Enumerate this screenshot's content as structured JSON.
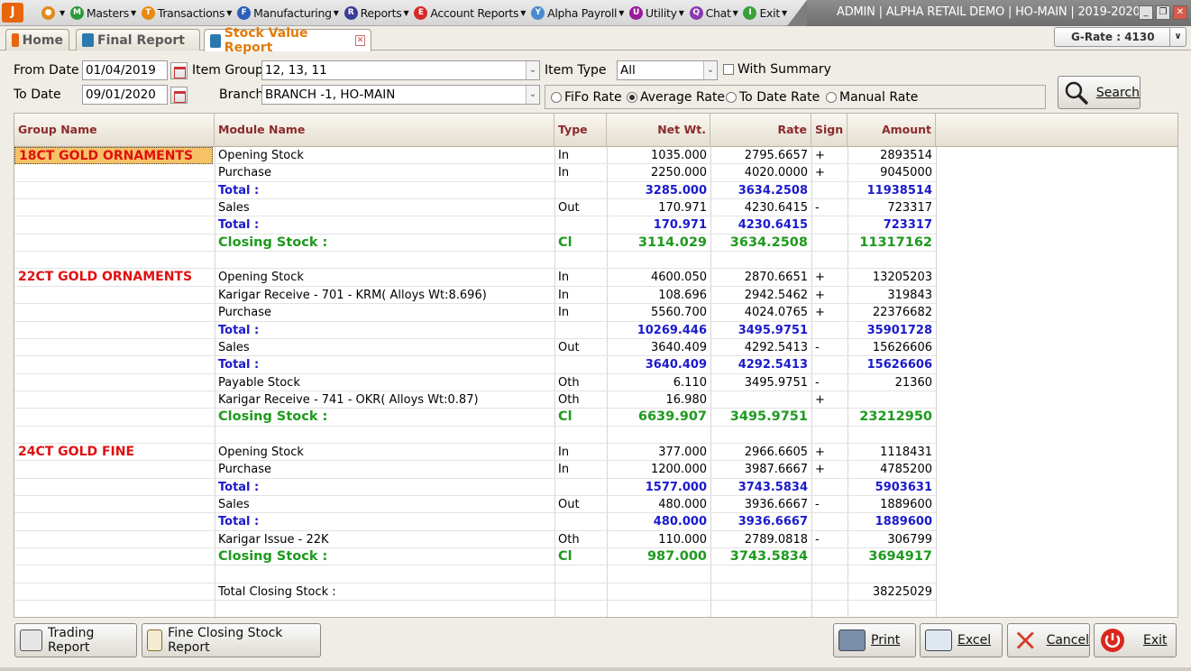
{
  "app": {
    "window_title": "ADMIN | ALPHA RETAIL DEMO | HO-MAIN | 2019-2020",
    "logo_letter": "J"
  },
  "menu": [
    {
      "label": "Masters",
      "icon": "M",
      "color": "#2a9a3a"
    },
    {
      "label": "Transactions",
      "icon": "T",
      "color": "#e88a12"
    },
    {
      "label": "Manufacturing",
      "icon": "F",
      "color": "#2b5fb8"
    },
    {
      "label": "Reports",
      "icon": "R",
      "color": "#3a3a9a"
    },
    {
      "label": "Account Reports",
      "icon": "E",
      "color": "#d62a2a"
    },
    {
      "label": "Alpha Payroll",
      "icon": "Y",
      "color": "#4a8ad0"
    },
    {
      "label": "Utility",
      "icon": "U",
      "color": "#9a1a9a"
    },
    {
      "label": "Chat",
      "icon": "Q",
      "color": "#8a3ab0"
    },
    {
      "label": "Exit",
      "icon": "I",
      "color": "#3aa03a"
    }
  ],
  "tabs": {
    "home": "Home",
    "final_report": "Final Report",
    "stock_value_report": "Stock Value Report"
  },
  "grate": "G-Rate : 4130",
  "filters": {
    "from_date_label": "From Date",
    "from_date": "01/04/2019",
    "to_date_label": "To Date",
    "to_date": "09/01/2020",
    "item_group_label": "Item Group",
    "item_group": "12, 13, 11",
    "branch_label": "Branch",
    "branch": "BRANCH -1, HO-MAIN",
    "item_type_label": "Item Type",
    "item_type": "All",
    "with_summary_label": "With Summary",
    "rates": {
      "fifo": "FiFo Rate",
      "average": "Average Rate",
      "to_date": "To Date Rate",
      "manual": "Manual Rate"
    },
    "selected_rate": "average",
    "search_label": "Search"
  },
  "grid": {
    "columns": {
      "group": "Group Name",
      "module": "Module Name",
      "type": "Type",
      "net_wt": "Net Wt.",
      "rate": "Rate",
      "sign": "Sign",
      "amount": "Amount"
    },
    "rows": [
      {
        "kind": "data",
        "group": "18CT GOLD ORNAMENTS",
        "group_selected": true,
        "module": "Opening Stock",
        "type": "In",
        "net_wt": "1035.000",
        "rate": "2795.6657",
        "sign": "+",
        "amount": "2893514"
      },
      {
        "kind": "data",
        "group": "",
        "module": "Purchase",
        "type": "In",
        "net_wt": "2250.000",
        "rate": "4020.0000",
        "sign": "+",
        "amount": "9045000"
      },
      {
        "kind": "total",
        "group": "",
        "module": "Total :",
        "type": "",
        "net_wt": "3285.000",
        "rate": "3634.2508",
        "sign": "",
        "amount": "11938514"
      },
      {
        "kind": "data",
        "group": "",
        "module": "Sales",
        "type": "Out",
        "net_wt": "170.971",
        "rate": "4230.6415",
        "sign": "-",
        "amount": "723317"
      },
      {
        "kind": "total",
        "group": "",
        "module": "Total :",
        "type": "",
        "net_wt": "170.971",
        "rate": "4230.6415",
        "sign": "",
        "amount": "723317"
      },
      {
        "kind": "closing",
        "group": "",
        "module": "Closing Stock :",
        "type": "Cl",
        "net_wt": "3114.029",
        "rate": "3634.2508",
        "sign": "",
        "amount": "11317162"
      },
      {
        "kind": "blank",
        "group": "",
        "module": "",
        "type": "",
        "net_wt": "",
        "rate": "",
        "sign": "",
        "amount": ""
      },
      {
        "kind": "data",
        "group": "22CT GOLD ORNAMENTS",
        "module": "Opening Stock",
        "type": "In",
        "net_wt": "4600.050",
        "rate": "2870.6651",
        "sign": "+",
        "amount": "13205203"
      },
      {
        "kind": "data",
        "group": "",
        "module": "Karigar Receive - 701 - KRM( Alloys Wt:8.696)",
        "type": "In",
        "net_wt": "108.696",
        "rate": "2942.5462",
        "sign": "+",
        "amount": "319843"
      },
      {
        "kind": "data",
        "group": "",
        "module": "Purchase",
        "type": "In",
        "net_wt": "5560.700",
        "rate": "4024.0765",
        "sign": "+",
        "amount": "22376682"
      },
      {
        "kind": "total",
        "group": "",
        "module": "Total :",
        "type": "",
        "net_wt": "10269.446",
        "rate": "3495.9751",
        "sign": "",
        "amount": "35901728"
      },
      {
        "kind": "data",
        "group": "",
        "module": "Sales",
        "type": "Out",
        "net_wt": "3640.409",
        "rate": "4292.5413",
        "sign": "-",
        "amount": "15626606"
      },
      {
        "kind": "total",
        "group": "",
        "module": "Total :",
        "type": "",
        "net_wt": "3640.409",
        "rate": "4292.5413",
        "sign": "",
        "amount": "15626606"
      },
      {
        "kind": "data",
        "group": "",
        "module": "Payable Stock",
        "type": "Oth",
        "net_wt": "6.110",
        "rate": "3495.9751",
        "sign": "-",
        "amount": "21360"
      },
      {
        "kind": "data",
        "group": "",
        "module": "Karigar Receive - 741 - OKR( Alloys Wt:0.87)",
        "type": "Oth",
        "net_wt": "16.980",
        "rate": "",
        "sign": "+",
        "amount": ""
      },
      {
        "kind": "closing",
        "group": "",
        "module": "Closing Stock :",
        "type": "Cl",
        "net_wt": "6639.907",
        "rate": "3495.9751",
        "sign": "",
        "amount": "23212950"
      },
      {
        "kind": "blank",
        "group": "",
        "module": "",
        "type": "",
        "net_wt": "",
        "rate": "",
        "sign": "",
        "amount": ""
      },
      {
        "kind": "data",
        "group": "24CT GOLD FINE",
        "module": "Opening Stock",
        "type": "In",
        "net_wt": "377.000",
        "rate": "2966.6605",
        "sign": "+",
        "amount": "1118431"
      },
      {
        "kind": "data",
        "group": "",
        "module": "Purchase",
        "type": "In",
        "net_wt": "1200.000",
        "rate": "3987.6667",
        "sign": "+",
        "amount": "4785200"
      },
      {
        "kind": "total",
        "group": "",
        "module": "Total :",
        "type": "",
        "net_wt": "1577.000",
        "rate": "3743.5834",
        "sign": "",
        "amount": "5903631"
      },
      {
        "kind": "data",
        "group": "",
        "module": "Sales",
        "type": "Out",
        "net_wt": "480.000",
        "rate": "3936.6667",
        "sign": "-",
        "amount": "1889600"
      },
      {
        "kind": "total",
        "group": "",
        "module": "Total :",
        "type": "",
        "net_wt": "480.000",
        "rate": "3936.6667",
        "sign": "",
        "amount": "1889600"
      },
      {
        "kind": "data",
        "group": "",
        "module": "Karigar Issue - 22K",
        "type": "Oth",
        "net_wt": "110.000",
        "rate": "2789.0818",
        "sign": "-",
        "amount": "306799"
      },
      {
        "kind": "closing",
        "group": "",
        "module": "Closing Stock :",
        "type": "Cl",
        "net_wt": "987.000",
        "rate": "3743.5834",
        "sign": "",
        "amount": "3694917"
      },
      {
        "kind": "blank",
        "group": "",
        "module": "",
        "type": "",
        "net_wt": "",
        "rate": "",
        "sign": "",
        "amount": ""
      },
      {
        "kind": "data",
        "group": "",
        "module": "Total Closing Stock :",
        "type": "",
        "net_wt": "",
        "rate": "",
        "sign": "",
        "amount": "38225029"
      },
      {
        "kind": "blank",
        "group": "",
        "module": "",
        "type": "",
        "net_wt": "",
        "rate": "",
        "sign": "",
        "amount": ""
      }
    ]
  },
  "footer": {
    "trading_report": "Trading Report",
    "fine_closing_stock_report": "Fine Closing Stock Report",
    "print": "Print",
    "excel": "Excel",
    "cancel": "Cancel",
    "exit": "Exit"
  }
}
